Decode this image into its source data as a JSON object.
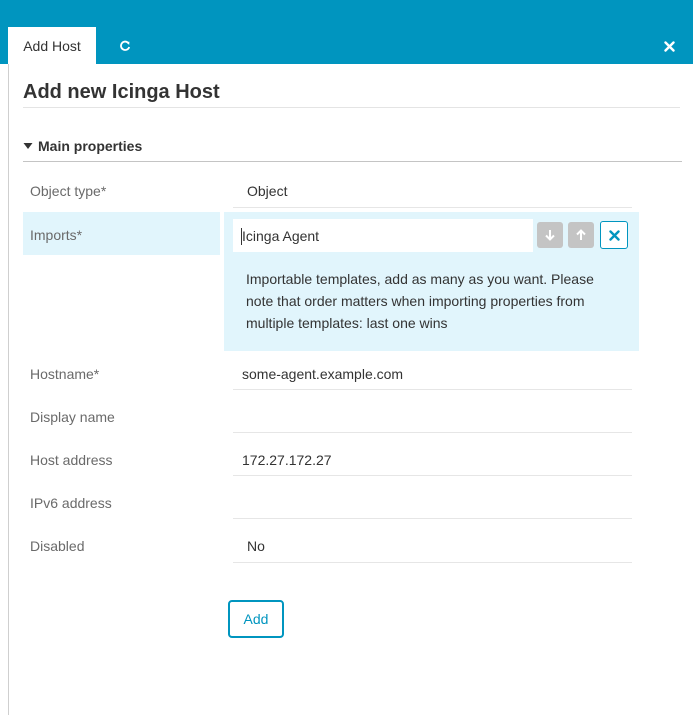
{
  "tabs": [
    {
      "label": "Add Host",
      "active": true
    },
    {
      "icon": "refresh-icon"
    }
  ],
  "close_icon": "close-icon",
  "page_title": "Add new Icinga Host",
  "section": {
    "label": "Main properties",
    "icon": "caret-down-icon",
    "expanded": true
  },
  "fields": {
    "object_type": {
      "label": "Object type*",
      "value": "Object"
    },
    "imports": {
      "label": "Imports*",
      "value": "Icinga Agent",
      "help": "Importable templates, add as many as you want. Please note that order matters when importing properties from multiple templates: last one wins",
      "buttons": [
        "move-down-icon",
        "move-up-icon",
        "remove-icon"
      ]
    },
    "hostname": {
      "label": "Hostname*",
      "value": "some-agent.example.com"
    },
    "display_name": {
      "label": "Display name",
      "value": ""
    },
    "host_address": {
      "label": "Host address",
      "value": "172.27.172.27"
    },
    "ipv6_address": {
      "label": "IPv6 address",
      "value": ""
    },
    "disabled": {
      "label": "Disabled",
      "value": "No"
    }
  },
  "submit_label": "Add",
  "colors": {
    "accent": "#0095bf",
    "highlight": "#e1f5fc"
  }
}
